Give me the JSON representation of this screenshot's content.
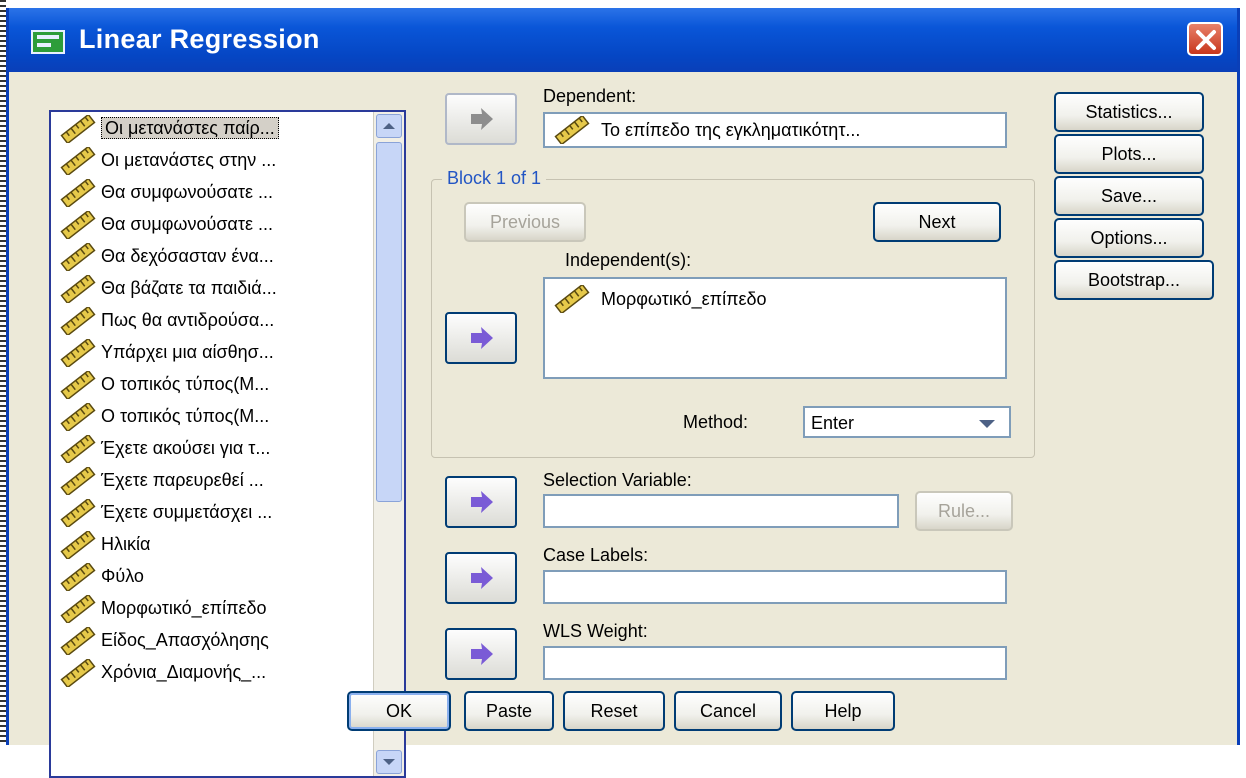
{
  "window": {
    "title": "Linear Regression"
  },
  "variables": [
    "Οι μετανάστες παίρ...",
    "Οι μετανάστες στην ...",
    "Θα συμφωνούσατε ...",
    "Θα συμφωνούσατε ...",
    "Θα δεχόσασταν ένα...",
    "Θα βάζατε τα παιδιά...",
    "Πως θα αντιδρούσα...",
    "Υπάρχει μια αίσθησ...",
    "Ο τοπικός τύπος(Μ...",
    "Ο τοπικός τύπος(Μ...",
    "Έχετε ακούσει για τ...",
    "Έχετε παρευρεθεί ...",
    "Έχετε συμμετάσχει ...",
    "Ηλικία",
    "Φύλο",
    "Μορφωτικό_επίπεδο",
    "Είδος_Απασχόλησης",
    "Χρόνια_Διαμονής_..."
  ],
  "dependent": {
    "label": "Dependent:",
    "value": "Το επίπεδο της εγκληματικότητ..."
  },
  "block": {
    "legend": "Block 1 of 1",
    "previous": "Previous",
    "next": "Next"
  },
  "independents": {
    "label": "Independent(s):",
    "items": [
      "Μορφωτικό_επίπεδο"
    ]
  },
  "method": {
    "label": "Method:",
    "value": "Enter"
  },
  "selection_variable": {
    "label": "Selection Variable:",
    "value": "",
    "rule": "Rule..."
  },
  "case_labels": {
    "label": "Case Labels:",
    "value": ""
  },
  "wls_weight": {
    "label": "WLS Weight:",
    "value": ""
  },
  "side_buttons": [
    "Statistics...",
    "Plots...",
    "Save...",
    "Options...",
    "Bootstrap..."
  ],
  "bottom_buttons": [
    "OK",
    "Paste",
    "Reset",
    "Cancel",
    "Help"
  ],
  "colors": {
    "titlebar": "#0a56d8",
    "dialog_bg": "#ece9d8",
    "button_border": "#003c74",
    "arrow_purple": "#7a5bd6"
  },
  "icons": {
    "variable": "ruler-scale-icon",
    "move": "right-arrow-icon",
    "close": "close-x-icon"
  }
}
